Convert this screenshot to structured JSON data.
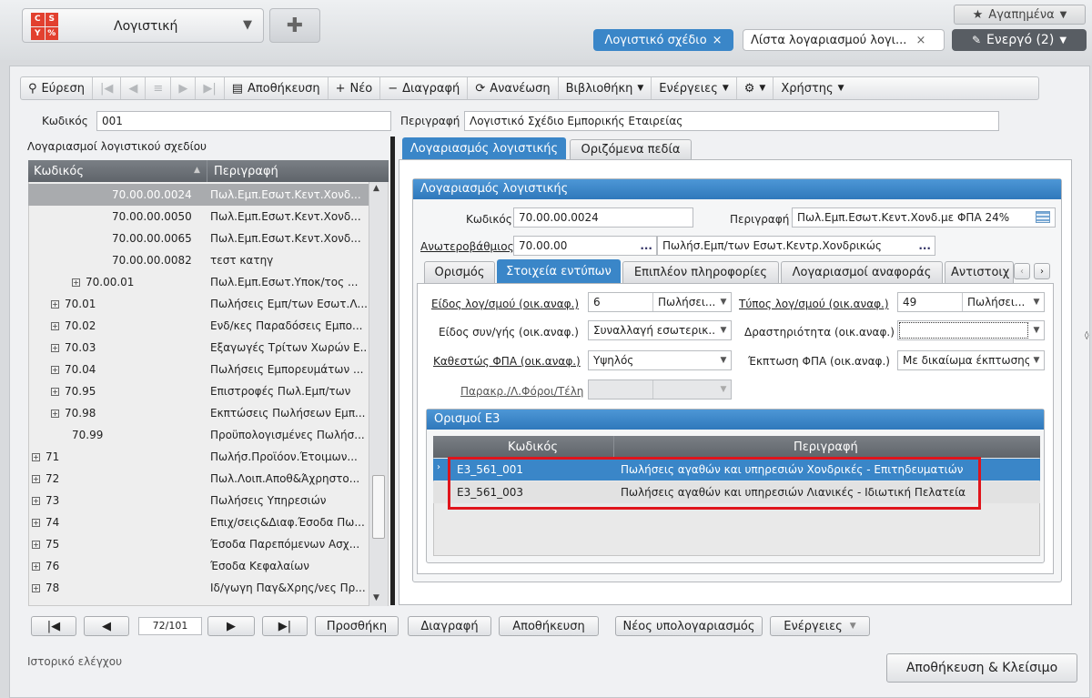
{
  "topbar": {
    "logo_letters": [
      "C",
      "S",
      "Y",
      "%"
    ],
    "app_selector": "Λογιστική",
    "favorites": "Αγαπημένα",
    "open_tabs": [
      {
        "label": "Λογιστικό σχέδιο",
        "close": "×"
      },
      {
        "label": "Λίστα λογαριασμού λογι...",
        "close": "×"
      }
    ],
    "active_label": "Ενεργό (2)"
  },
  "toolbar": {
    "find": "Εύρεση",
    "save": "Αποθήκευση",
    "new": "Νέο",
    "delete": "Διαγραφή",
    "refresh": "Ανανέωση",
    "library": "Βιβλιοθήκη",
    "actions": "Ενέργειες",
    "user": "Χρήστης"
  },
  "header_fields": {
    "code_label": "Κωδικός",
    "code_value": "001",
    "desc_label": "Περιγραφή",
    "desc_value": "Λογιστικό Σχέδιο Εμπορικής Εταιρείας"
  },
  "accounts_grid": {
    "title": "Λογαριασμοί λογιστικού σχεδίου",
    "col_code": "Κωδικός",
    "col_desc": "Περιγραφή",
    "rows": [
      {
        "code": "70.00.00.0024",
        "desc": "Πωλ.Εμπ.Εσωτ.Κεντ.Χονδ..."
      },
      {
        "code": "70.00.00.0050",
        "desc": "Πωλ.Εμπ.Εσωτ.Κεντ.Χονδ..."
      },
      {
        "code": "70.00.00.0065",
        "desc": "Πωλ.Εμπ.Εσωτ.Κεντ.Χονδ..."
      },
      {
        "code": "70.00.00.0082",
        "desc": "τεστ κατηγ"
      },
      {
        "code": "70.00.01",
        "desc": "Πωλ.Εμπ.Εσωτ.Υποκ/τος ..."
      },
      {
        "code": "70.01",
        "desc": "Πωλήσεις Εμπ/των Εσωτ.Λ..."
      },
      {
        "code": "70.02",
        "desc": "Ενδ/κες Παραδόσεις Εμπο..."
      },
      {
        "code": "70.03",
        "desc": "Εξαγωγές Τρίτων Χωρών Ε..."
      },
      {
        "code": "70.04",
        "desc": "Πωλήσεις Εμπορευμάτων ..."
      },
      {
        "code": "70.95",
        "desc": "Επιστροφές Πωλ.Εμπ/των"
      },
      {
        "code": "70.98",
        "desc": "Εκπτώσεις Πωλήσεων Εμπ..."
      },
      {
        "code": "70.99",
        "desc": "Προϋπολογισμένες Πωλήσ..."
      },
      {
        "code": "71",
        "desc": "Πωλήσ.Προϊόον.Έτοιμων..."
      },
      {
        "code": "72",
        "desc": "Πωλ.Λοιπ.Αποθ&Άχρηστο..."
      },
      {
        "code": "73",
        "desc": "Πωλήσεις Υπηρεσιών"
      },
      {
        "code": "74",
        "desc": "Επιχ/σεις&Διαφ.Έσοδα Πω..."
      },
      {
        "code": "75",
        "desc": "Έσοδα Παρεπόμενων Ασχ..."
      },
      {
        "code": "76",
        "desc": "Έσοδα Κεφαλαίων"
      },
      {
        "code": "78",
        "desc": "Ιδ/γωγη Παγ&Χρης/νες Πρ..."
      }
    ]
  },
  "pager": {
    "position": "72/101",
    "add": "Προσθήκη",
    "delete": "Διαγραφή",
    "save": "Αποθήκευση",
    "new_sub": "Νέος υπολογαριασμός",
    "actions": "Ενέργειες"
  },
  "footer": {
    "history": "Ιστορικό ελέγχου",
    "save_close": "Αποθήκευση & Κλείσιμο"
  },
  "right_tabs": [
    "Λογαριασμός λογιστικής",
    "Οριζόμενα πεδία"
  ],
  "account": {
    "section_title": "Λογαριασμός λογιστικής",
    "code_label": "Κωδικός",
    "code_value": "70.00.00.0024",
    "desc_label": "Περιγραφή",
    "desc_value": "Πωλ.Εμπ.Εσωτ.Κεντ.Χονδ.με ΦΠΑ 24%",
    "parent_label": "Ανωτεροβάθμιος",
    "parent_code": "70.00.00",
    "parent_desc": "Πωλήσ.Εμπ/των Εσωτ.Κεντρ.Χονδρικώς",
    "ellipsis": "..."
  },
  "sub_tabs": [
    "Ορισμός",
    "Στοιχεία εντύπων",
    "Επιπλέον πληροφορίες",
    "Λογαριασμοί αναφοράς",
    "Αντιστοιχ"
  ],
  "form": {
    "kind_label": "Είδος λογ/σμού (οικ.αναφ.)",
    "kind_code": "6",
    "kind_value": "Πωλήσει...",
    "type_label": "Τύπος λογ/σμού (οικ.αναφ.)",
    "type_code": "49",
    "type_value": "Πωλήσει...",
    "trans_label": "Είδος συν/γής (οικ.αναφ.)",
    "trans_value": "Συναλλαγή εσωτερικ...",
    "activity_label": "Δραστηριότητα (οικ.αναφ.)",
    "activity_value": "",
    "vat_label": "Καθεστώς ΦΠΑ (οικ.αναφ.)",
    "vat_value": "Υψηλός",
    "deduct_label": "Έκπτωση ΦΠΑ (οικ.αναφ.)",
    "deduct_value": "Με δικαίωμα έκπτωσης",
    "taxes_label": "Παρακρ./Λ.Φόροι/Τέλη"
  },
  "e3": {
    "title": "Ορισμοί Ε3",
    "col_code": "Κωδικός",
    "col_desc": "Περιγραφή",
    "rows": [
      {
        "code": "Ε3_561_001",
        "desc": "Πωλήσεις αγαθών και υπηρεσιών Χονδρικές - Επιτηδευματιών"
      },
      {
        "code": "Ε3_561_003",
        "desc": "Πωλήσεις αγαθών και υπηρεσιών Λιανικές - Ιδιωτική Πελατεία"
      }
    ]
  },
  "colors": {
    "accent": "#3a86c8",
    "highlight_box": "#e0141b",
    "selected_row": "#a9abae"
  }
}
